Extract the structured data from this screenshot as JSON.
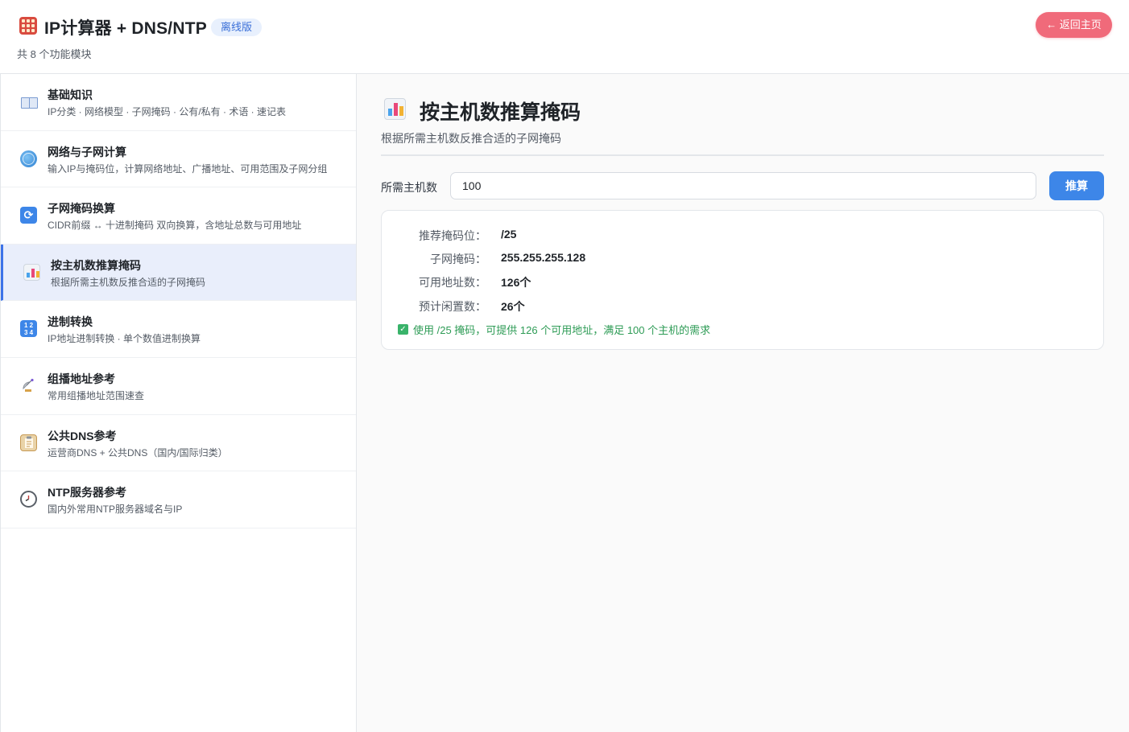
{
  "header": {
    "title": "IP计算器 + DNS/NTP",
    "badge": "离线版",
    "module_count": "共 8 个功能模块",
    "back_label": "← 返回主页",
    "app_icon": "abacus-icon"
  },
  "sidebar": {
    "items": [
      {
        "icon": "book-icon",
        "title": "基础知识",
        "desc": "IP分类 · 网络模型 · 子网掩码 · 公有/私有 · 术语 · 速记表"
      },
      {
        "icon": "globe-icon",
        "title": "网络与子网计算",
        "desc": "输入IP与掩码位，计算网络地址、广播地址、可用范围及子网分组"
      },
      {
        "icon": "refresh-icon",
        "title": "子网掩码换算",
        "desc": "CIDR前缀 ↔ 十进制掩码 双向换算，含地址总数与可用地址"
      },
      {
        "icon": "bar-chart-icon",
        "title": "按主机数推算掩码",
        "desc": "根据所需主机数反推合适的子网掩码",
        "active": true
      },
      {
        "icon": "numbers-icon",
        "title": "进制转换",
        "desc": "IP地址进制转换 · 单个数值进制换算"
      },
      {
        "icon": "satellite-dish-icon",
        "title": "组播地址参考",
        "desc": "常用组播地址范围速查"
      },
      {
        "icon": "clipboard-icon",
        "title": "公共DNS参考",
        "desc": "运营商DNS + 公共DNS（国内/国际归类）"
      },
      {
        "icon": "clock-icon",
        "title": "NTP服务器参考",
        "desc": "国内外常用NTP服务器域名与IP"
      }
    ]
  },
  "main": {
    "icon": "bar-chart-icon",
    "title": "按主机数推算掩码",
    "subtitle": "根据所需主机数反推合适的子网掩码",
    "input_label": "所需主机数",
    "input_value": "100",
    "button_label": "推算",
    "results": [
      {
        "label": "推荐掩码位：",
        "value": "/25"
      },
      {
        "label": "子网掩码：",
        "value": "255.255.255.128"
      },
      {
        "label": "可用地址数：",
        "value": "126个"
      },
      {
        "label": "预计闲置数：",
        "value": "26个"
      }
    ],
    "note": "使用 /25 掩码，可提供 126 个可用地址，满足 100 个主机的需求"
  },
  "colors": {
    "accent": "#3d86e8",
    "back_button": "#f06a7a",
    "active_item_bg": "#e9eefb",
    "success": "#2d9b55"
  }
}
